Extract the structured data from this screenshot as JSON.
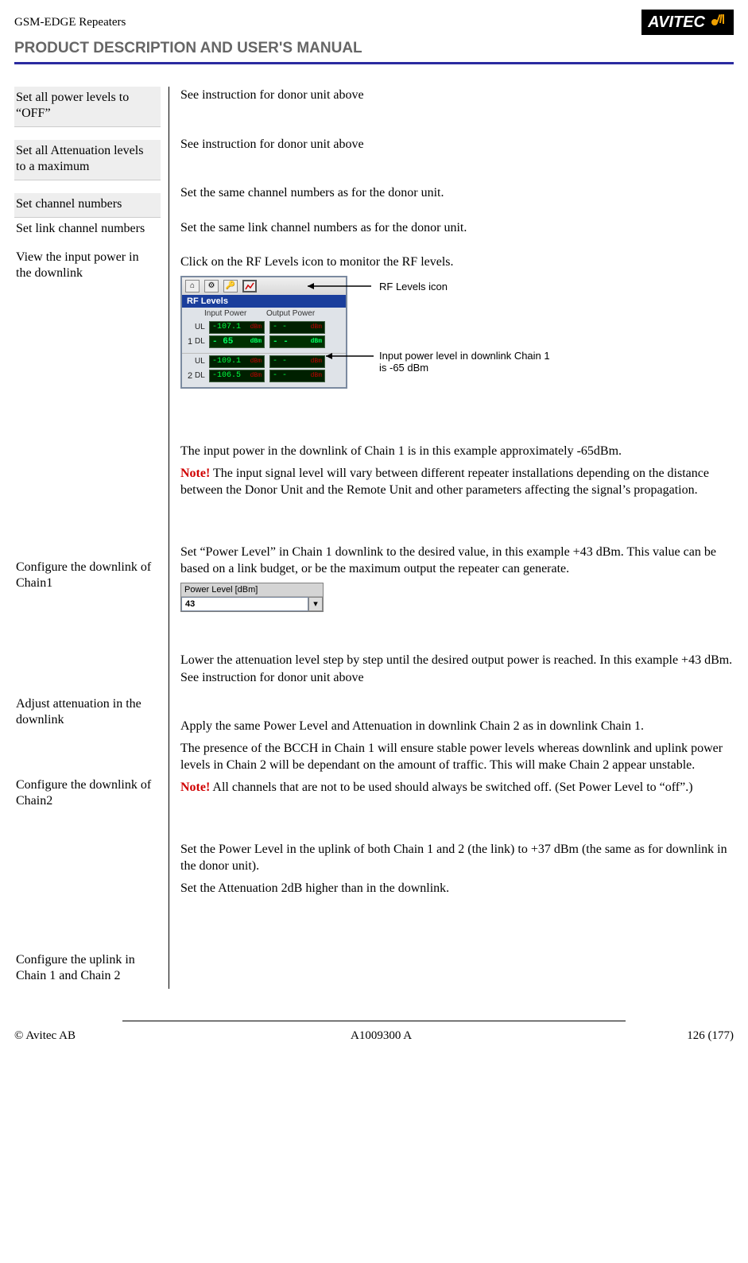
{
  "header": {
    "product_line": "GSM-EDGE Repeaters",
    "brand": "AVITEC",
    "manual_title": "PRODUCT DESCRIPTION AND USER'S MANUAL"
  },
  "rows": {
    "off": {
      "left": "Set all power levels to “OFF”",
      "right": "See instruction for donor unit above"
    },
    "atten": {
      "left": "Set all Attenuation levels to a maximum",
      "right": "See instruction for donor unit above"
    },
    "chan": {
      "left": "Set channel numbers",
      "right": "Set the same channel numbers as for the donor unit."
    },
    "linkchan": {
      "left": "Set link channel numbers",
      "right": "Set the same link channel numbers as for the donor unit."
    },
    "view": {
      "left": "View the input power in the downlink",
      "intro": "Click on the RF Levels icon to monitor the RF levels.",
      "annot_icon": "RF Levels icon",
      "annot_dl": "Input power level in downlink Chain 1 is -65 dBm",
      "after1": "The input power in the downlink of Chain 1 is in this example approximately -65dBm.",
      "note_label": "Note!",
      "note": " The input signal level will vary between different repeater installations depending on the distance between the Donor Unit and the Remote Unit and other parameters affecting the signal’s propagation."
    },
    "cfg_dl1": {
      "left": "Configure the downlink of Chain1",
      "text": "Set “Power Level” in Chain 1 downlink to the desired value, in this example +43 dBm. This value can be based on a link budget, or be the maximum output the repeater can generate."
    },
    "adj_att": {
      "left": "Adjust attenuation in the downlink",
      "text": "Lower the attenuation level step by step until the desired output power is reached. In this example +43 dBm. See instruction for donor unit above"
    },
    "cfg_dl2": {
      "left": "Configure the downlink of Chain2",
      "p1": "Apply the same Power Level and Attenuation in downlink Chain 2 as in downlink Chain 1.",
      "p2": "The presence of the BCCH in Chain 1 will ensure stable power levels whereas downlink and uplink power levels in Chain 2 will be dependant on the amount of traffic. This will make Chain 2 appear unstable.",
      "note_label": "Note!",
      "note": " All channels that are not to be used should always be switched off. (Set Power Level to “off”.)"
    },
    "cfg_ul": {
      "left": "Configure the uplink in Chain 1 and Chain 2",
      "p1": "Set the Power Level in the uplink of both Chain 1 and 2 (the link) to +37 dBm (the same as for downlink in the donor unit).",
      "p2": "Set the Attenuation 2dB higher than in the downlink."
    }
  },
  "rf_window": {
    "title": "RF Levels",
    "col1": "Input Power",
    "col2": "Output Power",
    "ch1_ul_in": "-107.1",
    "ch1_ul_in_u": "dBm",
    "ch1_ul_out": "- -",
    "ch1_ul_out_u": "dBm",
    "ch1_dl_in": "- 65",
    "ch1_dl_in_u": "dBm",
    "ch1_dl_out": "- -",
    "ch1_dl_out_u": "dBm",
    "ch2_ul_in": "-109.1",
    "ch2_ul_in_u": "dBm",
    "ch2_ul_out": "- -",
    "ch2_ul_out_u": "dBm",
    "ch2_dl_in": "-106.5",
    "ch2_dl_in_u": "dBm",
    "ch2_dl_out": "- -",
    "ch2_dl_out_u": "dBm",
    "lbl_ul": "UL",
    "lbl_dl": "DL",
    "lbl_1": "1",
    "lbl_2": "2"
  },
  "power_level": {
    "title": "Power Level [dBm]",
    "value": "43"
  },
  "footer": {
    "copyright": "© Avitec AB",
    "docnum": "A1009300 A",
    "page": "126 (177)"
  }
}
